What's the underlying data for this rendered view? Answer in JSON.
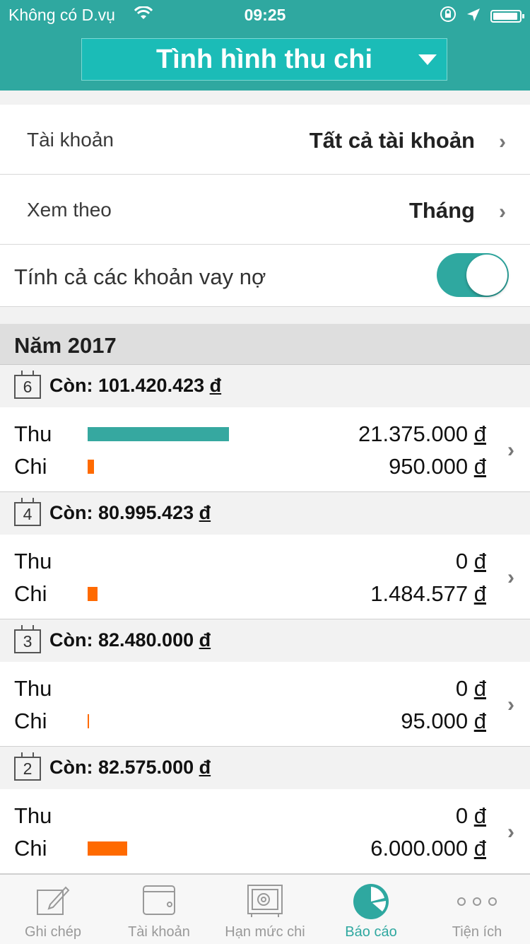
{
  "status": {
    "carrier": "Không có D.vụ",
    "time": "09:25"
  },
  "header": {
    "title": "Tình hình thu chi"
  },
  "settings": {
    "account_label": "Tài khoản",
    "account_value": "Tất cả tài khoản",
    "view_label": "Xem theo",
    "view_value": "Tháng",
    "include_loans_label": "Tính cả các khoản vay nợ",
    "include_loans_on": true
  },
  "year_label": "Năm 2017",
  "currency": "đ",
  "months": [
    {
      "month": "6",
      "remain": "Còn: 101.420.423",
      "thu_label": "Thu",
      "thu": "21.375.000",
      "chi_label": "Chi",
      "chi": "950.000"
    },
    {
      "month": "4",
      "remain": "Còn: 80.995.423",
      "thu_label": "Thu",
      "thu": "0",
      "chi_label": "Chi",
      "chi": "1.484.577"
    },
    {
      "month": "3",
      "remain": "Còn: 82.480.000",
      "thu_label": "Thu",
      "thu": "0",
      "chi_label": "Chi",
      "chi": "95.000"
    },
    {
      "month": "2",
      "remain": "Còn: 82.575.000",
      "thu_label": "Thu",
      "thu": "0",
      "chi_label": "Chi",
      "chi": "6.000.000"
    }
  ],
  "tabs": [
    {
      "label": "Ghi chép",
      "icon": "pencil-note-icon",
      "active": false
    },
    {
      "label": "Tài khoản",
      "icon": "wallet-icon",
      "active": false
    },
    {
      "label": "Hạn mức chi",
      "icon": "safe-icon",
      "active": false
    },
    {
      "label": "Báo cáo",
      "icon": "pie-chart-icon",
      "active": true
    },
    {
      "label": "Tiện ích",
      "icon": "more-dots-icon",
      "active": false
    }
  ],
  "colors": {
    "accent": "#2fa8a0",
    "income_bar": "#36a8a0",
    "expense_bar": "#ff6a00"
  }
}
